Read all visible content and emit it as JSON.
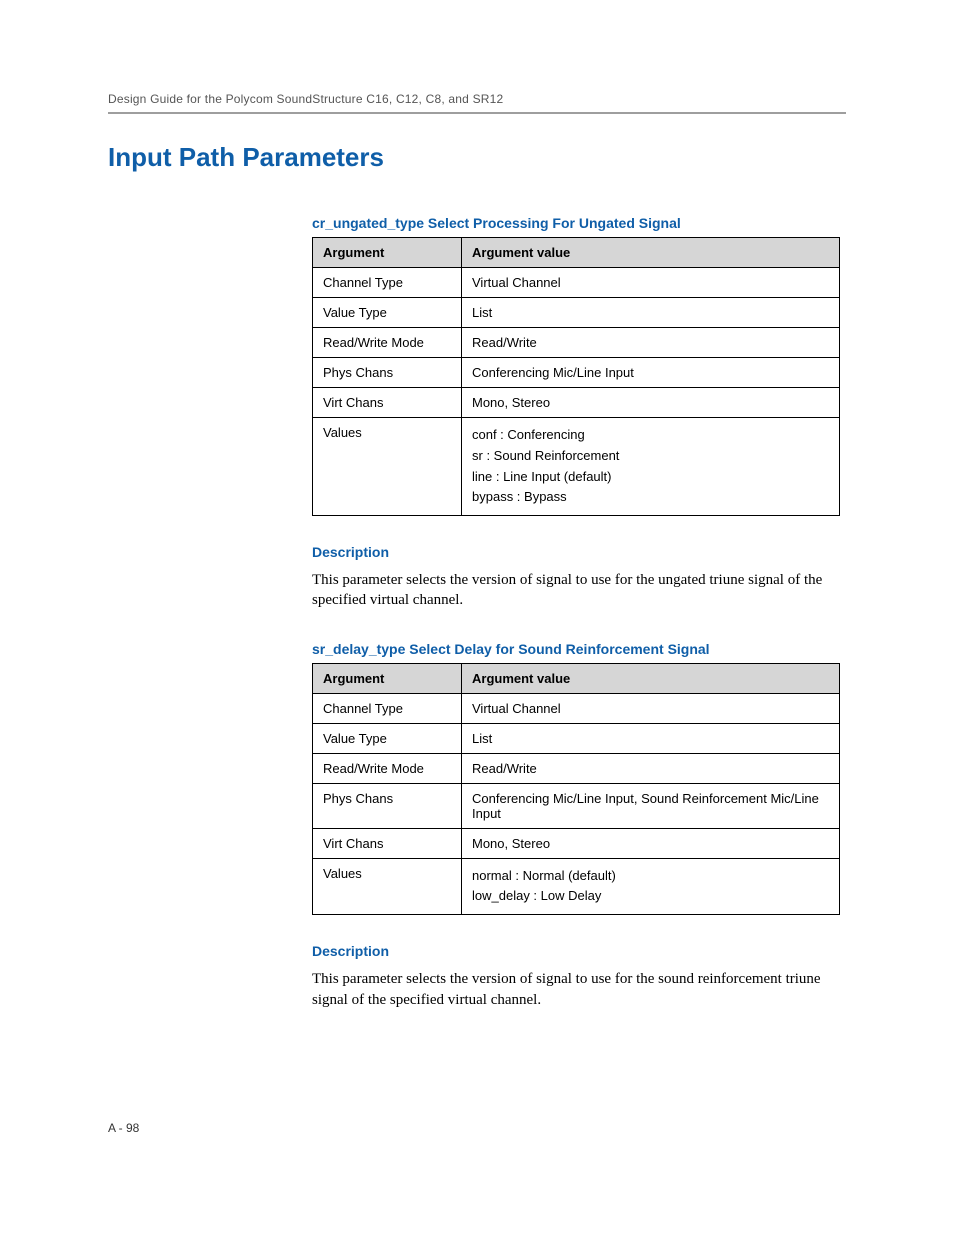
{
  "running_head": "Design Guide for the Polycom SoundStructure C16, C12, C8, and SR12",
  "h1": "Input Path Parameters",
  "section1": {
    "title": "cr_ungated_type Select Processing For Ungated Signal",
    "header": {
      "arg": "Argument",
      "val": "Argument value"
    },
    "rows": {
      "r0": {
        "k": "Channel Type",
        "v": "Virtual Channel"
      },
      "r1": {
        "k": "Value Type",
        "v": "List"
      },
      "r2": {
        "k": "Read/Write Mode",
        "v": "Read/Write"
      },
      "r3": {
        "k": "Phys Chans",
        "v": "Conferencing Mic/Line Input"
      },
      "r4": {
        "k": "Virt Chans",
        "v": "Mono, Stereo"
      },
      "r5": {
        "k": "Values",
        "v0": "conf : Conferencing",
        "v1": "sr : Sound Reinforcement",
        "v2": "line : Line Input (default)",
        "v3": "bypass : Bypass"
      }
    },
    "desc_label": "Description",
    "desc_text": "This parameter selects the version of signal to use for the ungated triune signal of the specified virtual channel."
  },
  "section2": {
    "title": "sr_delay_type Select Delay for Sound Reinforcement Signal",
    "header": {
      "arg": "Argument",
      "val": "Argument value"
    },
    "rows": {
      "r0": {
        "k": "Channel Type",
        "v": "Virtual Channel"
      },
      "r1": {
        "k": "Value Type",
        "v": "List"
      },
      "r2": {
        "k": "Read/Write Mode",
        "v": "Read/Write"
      },
      "r3": {
        "k": "Phys Chans",
        "v": "Conferencing Mic/Line Input, Sound Reinforcement Mic/Line Input"
      },
      "r4": {
        "k": "Virt Chans",
        "v": "Mono, Stereo"
      },
      "r5": {
        "k": "Values",
        "v0": "normal : Normal (default)",
        "v1": "low_delay : Low Delay"
      }
    },
    "desc_label": "Description",
    "desc_text": "This parameter selects the version of signal to use for the sound reinforcement triune signal of the specified virtual channel."
  },
  "page_num": "A - 98"
}
